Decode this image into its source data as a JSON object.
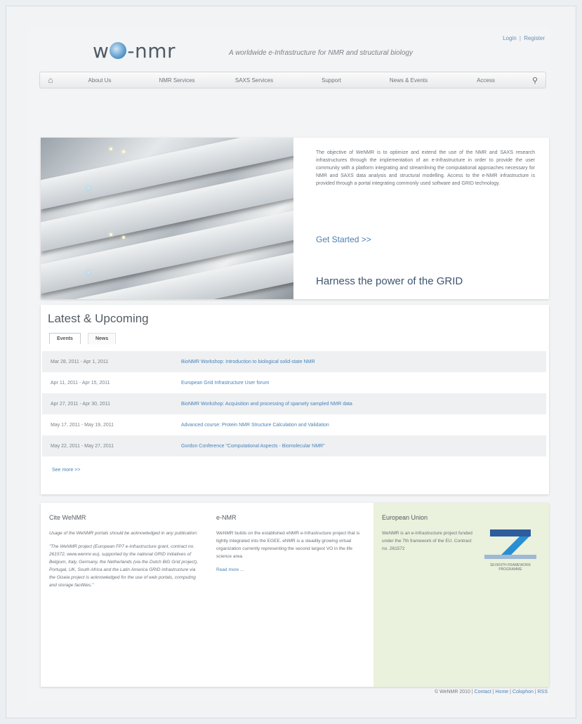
{
  "header": {
    "logo": "w nmr",
    "logo_left": "w",
    "logo_right": "-nmr",
    "tagline": "A worldwide e-Infrastructure for NMR and structural biology",
    "login": "Login",
    "register": "Register",
    "separator": "|"
  },
  "nav": {
    "items": [
      "About Us",
      "NMR Services",
      "SAXS Services",
      "Support",
      "News & Events",
      "Access"
    ]
  },
  "hero": {
    "text": "The objective of WeNMR is to optimize and extend the use of the NMR and SAXS research infrastructures through the implementation of an e-Infrastructure in order to provide the user community with a platform integrating and streamlining the computational approaches necessary for NMR and SAXS data analysis and structural modelling. Access to the e-NMR infrastructure is provided through a portal integrating commonly used software and GRID technology.",
    "get_started": "Get Started >>",
    "headline": "Harness the power of the GRID"
  },
  "latest": {
    "title": "Latest & Upcoming",
    "tabs": [
      "Events",
      "News"
    ],
    "events": [
      {
        "date": "Mar 28, 2011 - Apr 1, 2011",
        "title": "BioNMR Workshop: Introduction to biological solid-state NMR"
      },
      {
        "date": "Apr 11, 2011 - Apr 15, 2011",
        "title": "European Grid Infrastructure User forum"
      },
      {
        "date": "Apr 27, 2011 - Apr 30, 2011",
        "title": "BioNMR Workshop: Acquisition and processing of sparsely sampled NMR data"
      },
      {
        "date": "May 17, 2011 - May 19, 2011",
        "title": "Advanced course: Protein NMR Structure Calculation and Validation"
      },
      {
        "date": "May 22, 2011 - May 27, 2011",
        "title": "Gordon Conference \"Computational Aspects - Biomolecular NMR\""
      }
    ],
    "see_more": "See more >>"
  },
  "cite": {
    "title": "Cite WeNMR",
    "intro": "Usage of the WeNMR portals should be acknowledged in any publication:",
    "quote": "\"The WeNMR project (European FP7 e-Infrastructure grant, contract no. 261572, www.wenmr.eu), supported by the national GRID Initiatives of Belgium, Italy, Germany, the Netherlands (via the Dutch BiG Grid project), Portugal, UK, South Africa and the Latin America GRID infrastructure via the Gisela project is acknowledged for the use of web portals, computing and storage facilities.\""
  },
  "enmr": {
    "title": "e-NMR",
    "text": "WeNMR builds on the established eNMR e-Infrastructure project that is tightly integrated into the EGEE. eNMR is a steadily growing virtual organization currently representing the second largest VO in the life science area.",
    "read_more": "Read more ..."
  },
  "eu": {
    "title": "European Union",
    "text": "WeNMR is an e-Infrastructure project funded under the 7th framework of the EU. Contract no. 261572",
    "logo_caption": "SEVENTH FRAMEWORK PROGRAMME"
  },
  "footer": {
    "copyright": "© WeNMR 2010",
    "links": [
      "Contact",
      "Home",
      "Colophon",
      "RSS"
    ]
  }
}
